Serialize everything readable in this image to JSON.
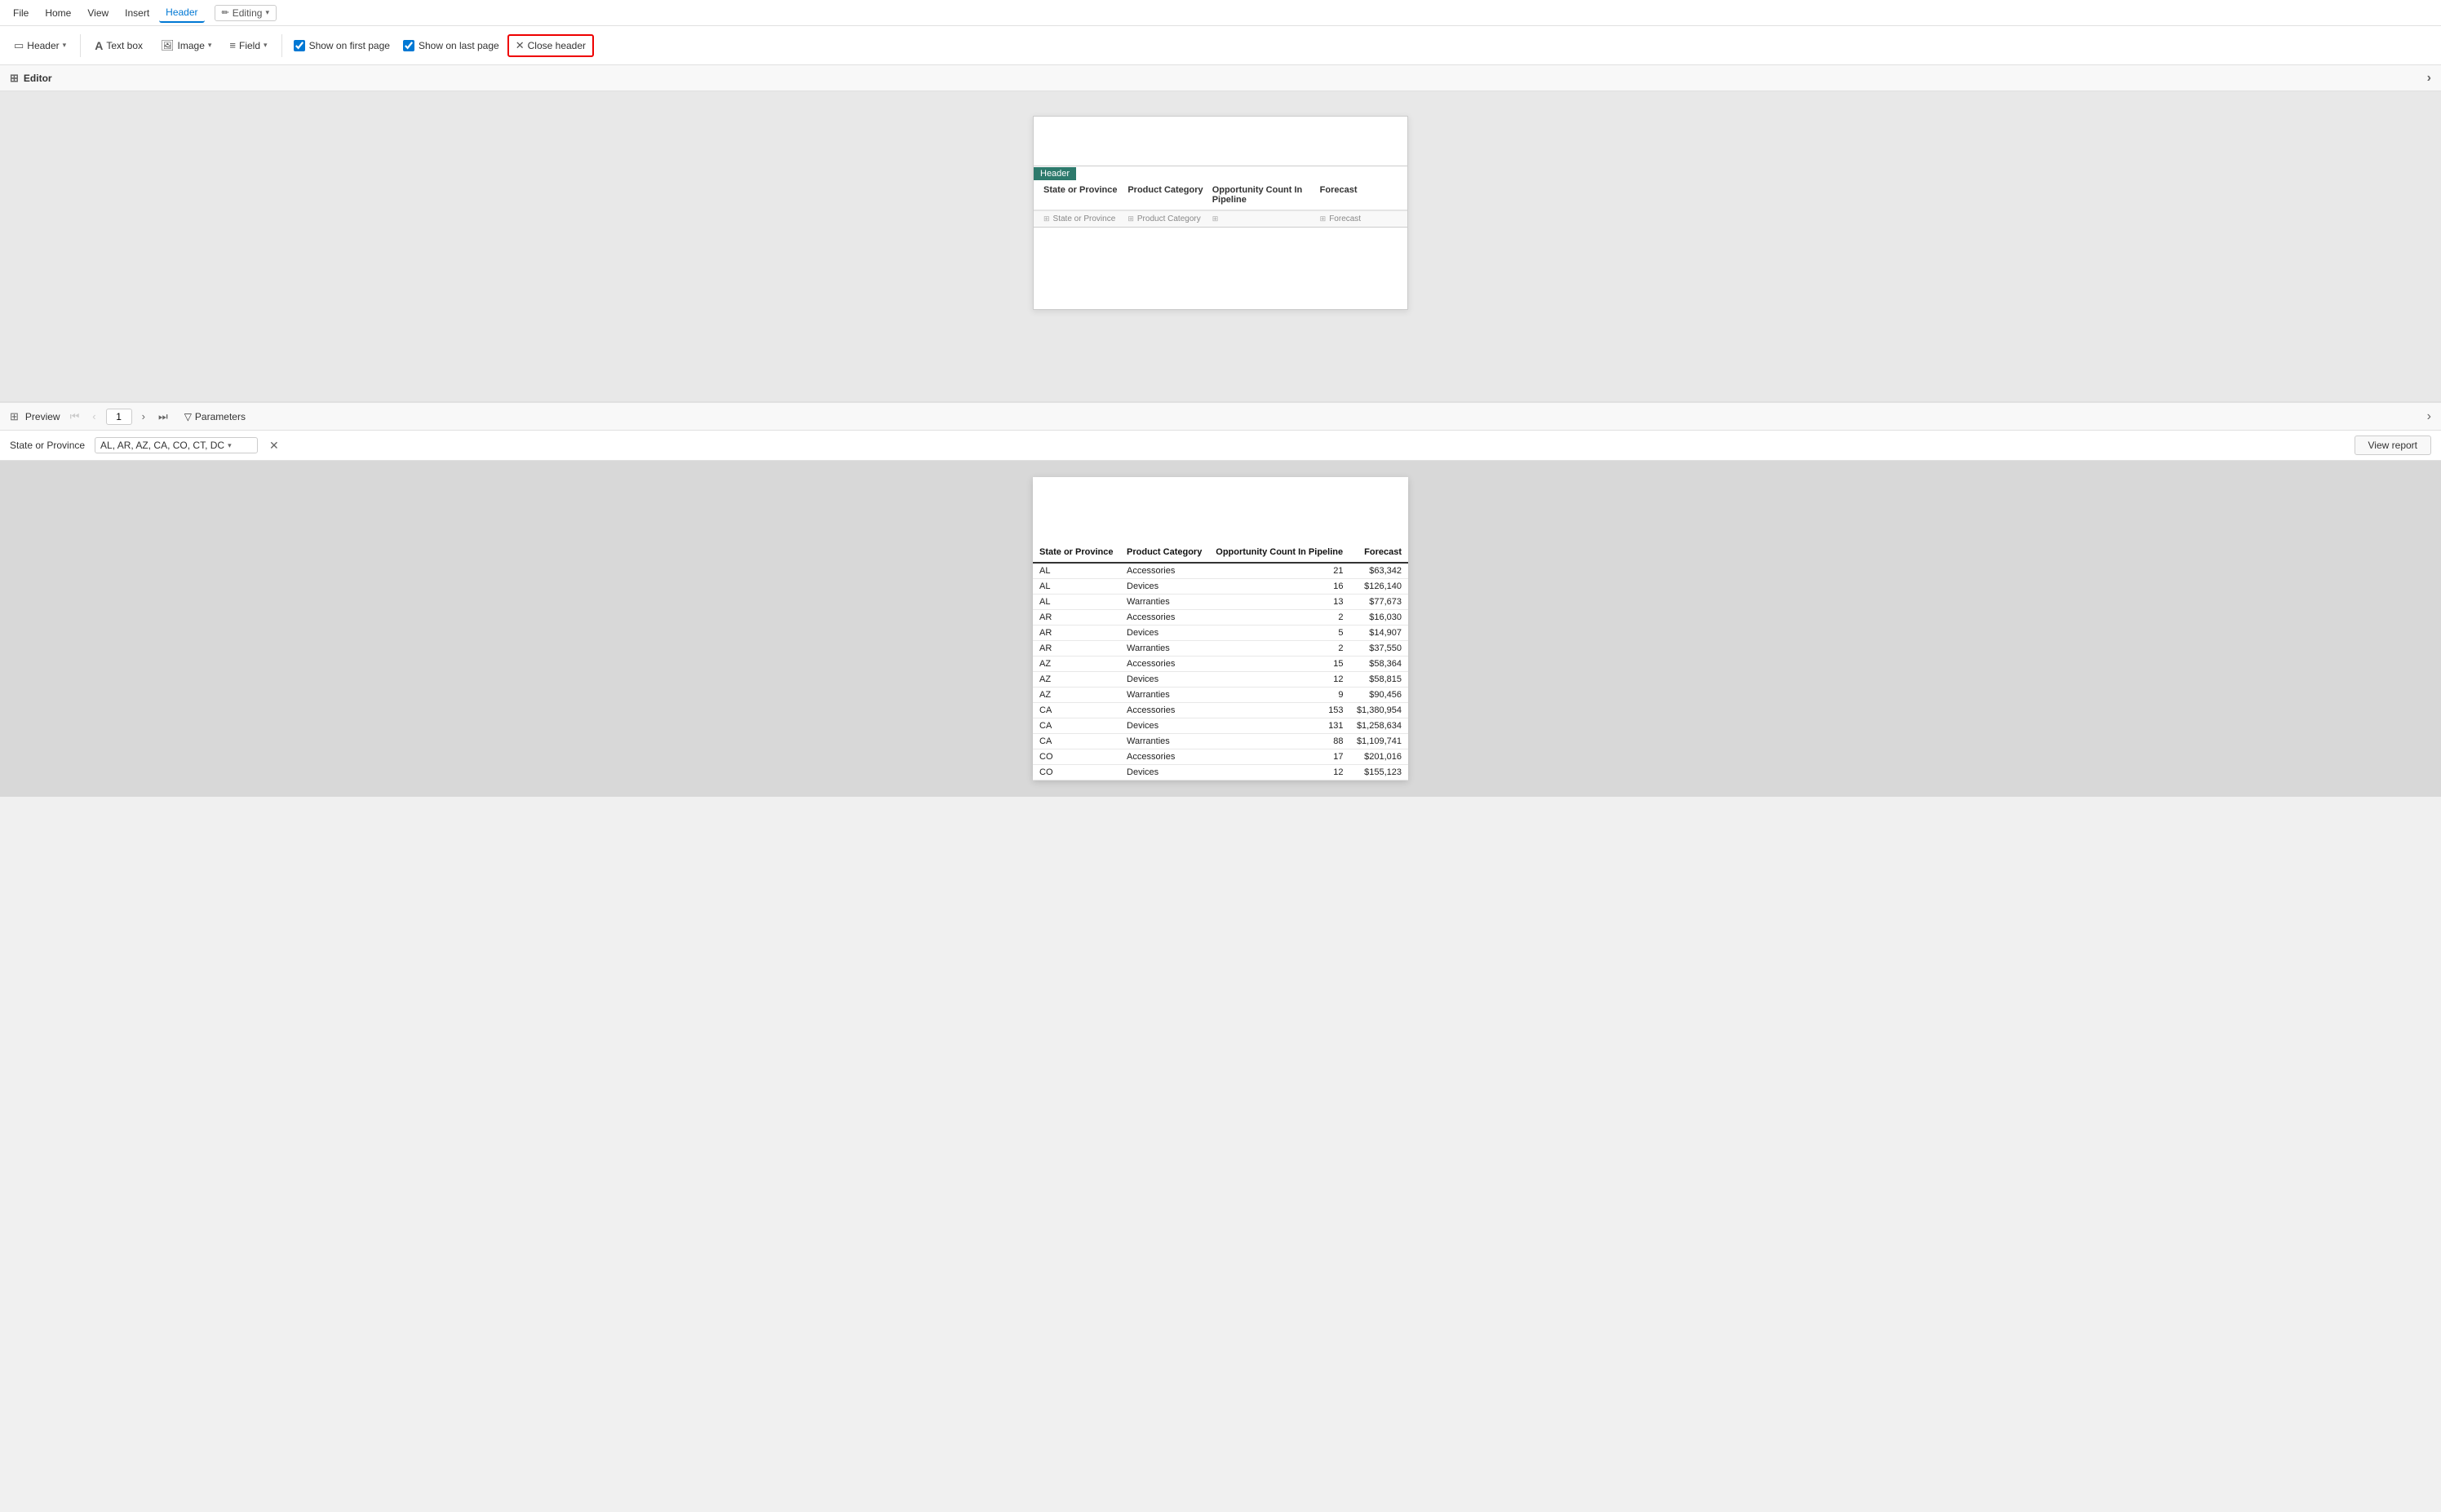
{
  "menuBar": {
    "items": [
      "File",
      "Home",
      "View",
      "Insert",
      "Header"
    ],
    "activeItem": "Header",
    "editingBadge": "Editing"
  },
  "ribbon": {
    "headerBtn": "Header",
    "textBoxBtn": "Text box",
    "imageBtn": "Image",
    "fieldBtn": "Field",
    "showFirstPageLabel": "Show on first page",
    "showLastPageLabel": "Show on last page",
    "closeHeaderBtn": "Close header",
    "showFirstPageChecked": true,
    "showLastPageChecked": true
  },
  "editor": {
    "toolbarLabel": "Editor"
  },
  "canvas": {
    "headerBadge": "Header",
    "columns": [
      "State or Province",
      "Product Category",
      "Opportunity Count In Pipeline",
      "Forecast"
    ],
    "fieldNames": [
      "State or Province",
      "Product Category",
      "",
      "Forecast"
    ]
  },
  "preview": {
    "toolbarLabel": "Preview",
    "pageNumber": "1",
    "parametersBtn": "Parameters"
  },
  "params": {
    "label": "State or Province",
    "value": "AL, AR, AZ, CA, CO, CT, DC",
    "viewReportBtn": "View report"
  },
  "table": {
    "headers": [
      "State or Province",
      "Product Category",
      "Opportunity Count In Pipeline",
      "Forecast"
    ],
    "rows": [
      [
        "AL",
        "Accessories",
        "21",
        "$63,342"
      ],
      [
        "AL",
        "Devices",
        "16",
        "$126,140"
      ],
      [
        "AL",
        "Warranties",
        "13",
        "$77,673"
      ],
      [
        "AR",
        "Accessories",
        "2",
        "$16,030"
      ],
      [
        "AR",
        "Devices",
        "5",
        "$14,907"
      ],
      [
        "AR",
        "Warranties",
        "2",
        "$37,550"
      ],
      [
        "AZ",
        "Accessories",
        "15",
        "$58,364"
      ],
      [
        "AZ",
        "Devices",
        "12",
        "$58,815"
      ],
      [
        "AZ",
        "Warranties",
        "9",
        "$90,456"
      ],
      [
        "CA",
        "Accessories",
        "153",
        "$1,380,954"
      ],
      [
        "CA",
        "Devices",
        "131",
        "$1,258,634"
      ],
      [
        "CA",
        "Warranties",
        "88",
        "$1,109,741"
      ],
      [
        "CO",
        "Accessories",
        "17",
        "$201,016"
      ],
      [
        "CO",
        "Devices",
        "12",
        "$155,123"
      ]
    ]
  },
  "icons": {
    "pencil": "✏",
    "grid": "⊞",
    "header": "▭",
    "textbox": "A",
    "image": "🖼",
    "field": "≡",
    "checkbox": "☑",
    "close": "✕",
    "collapseRight": "›",
    "navFirst": "⏮",
    "navPrev": "‹",
    "navNext": "›",
    "navLast": "⏭",
    "filter": "▽"
  }
}
